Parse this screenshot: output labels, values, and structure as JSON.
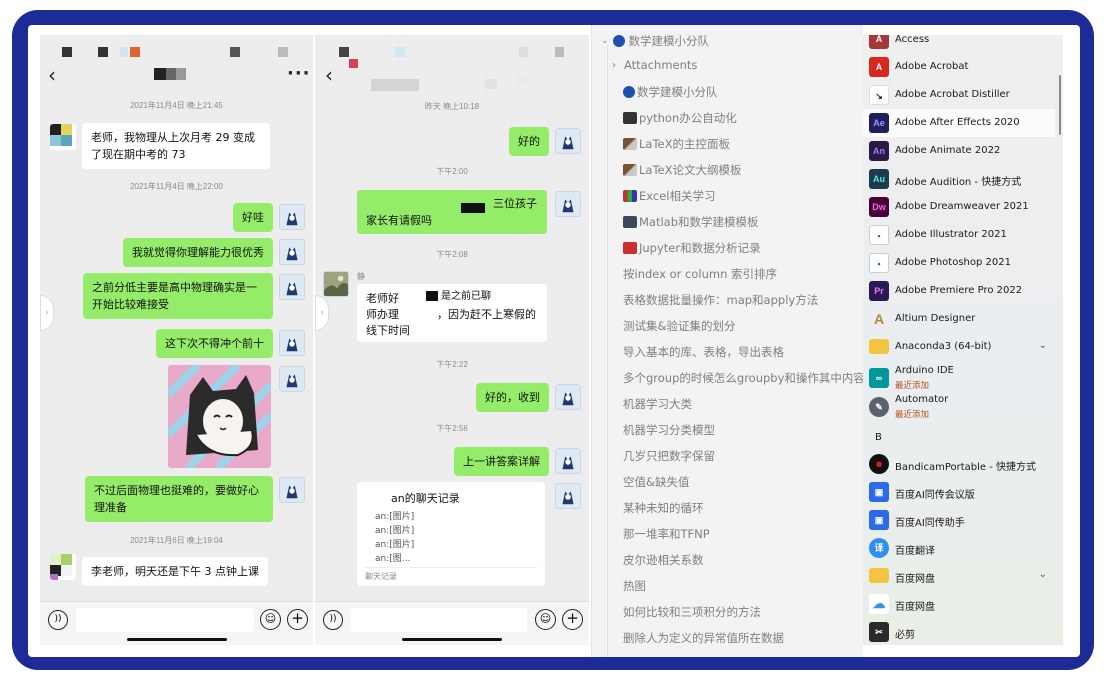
{
  "chat_left": {
    "timestamps": [
      "2021年11月4日 晚上21:45",
      "2021年11月4日 晚上22:00",
      "2021年11月6日 晚上19:04"
    ],
    "messages": [
      {
        "from": "student",
        "text": "老师，我物理从上次月考 29 变成了现在期中考的 73"
      },
      {
        "from": "teacher",
        "text": "好哇"
      },
      {
        "from": "teacher",
        "text": "我就觉得你理解能力很优秀"
      },
      {
        "from": "teacher",
        "text": "之前分低主要是高中物理确实是一开始比较难接受"
      },
      {
        "from": "teacher",
        "text": "这下次不得冲个前十"
      },
      {
        "from": "teacher",
        "text": "不过后面物理也挺难的，要做好心理准备"
      },
      {
        "from": "student",
        "text": "李老师，明天还是下午 3 点钟上课"
      }
    ]
  },
  "chat_right": {
    "timestamps": [
      "昨天 晚上10:18",
      "下午2:00",
      "下午2:08",
      "下午2:22",
      "下午2:56"
    ],
    "messages": [
      {
        "from": "teacher",
        "text": "好的"
      },
      {
        "from": "teacher",
        "text": "三位孩子",
        "text2": "家长有请假吗"
      },
      {
        "from": "parent",
        "name": "静",
        "text": "老师好",
        "text_frag1": "是之前已聊",
        "text2": "师办理",
        "text_frag2": "，因为赶不上寒假的",
        "text3": "线下时间"
      },
      {
        "from": "teacher",
        "text": "好的，收到"
      },
      {
        "from": "teacher",
        "text": "上一讲答案详解"
      }
    ],
    "record_card": {
      "title": "an的聊天记录",
      "lines": [
        "an:[图片]",
        "an:[图片]",
        "an:[图片]",
        "an:[图..."
      ],
      "footer": "聊天记录"
    }
  },
  "tree": {
    "root": "数学建模小分队",
    "items": [
      "Attachments",
      "数学建模小分队",
      "python办公自动化",
      "LaTeX的主控面板",
      "LaTeX论文大纲模板",
      "Excel相关学习",
      "Matlab和数学建模模板",
      "Jupyter和数据分析记录",
      "按index or column 索引排序",
      "表格数据批量操作：map和apply方法",
      "测试集&验证集的划分",
      "导入基本的库、表格，导出表格",
      "多个group的时候怎么groupby和操作其中内容",
      "机器学习大类",
      "机器学习分类模型",
      "几岁只把数字保留",
      "空值&缺失值",
      "某种未知的循环",
      "那一堆率和TFNP",
      "皮尔逊相关系数",
      "热图",
      "如何比较和三项积分的方法",
      "删除人为定义的异常值所在数据"
    ]
  },
  "start_menu": {
    "apps": [
      {
        "name": "Access",
        "icon": "access-icon",
        "color": "#a4373a",
        "glyph": "A"
      },
      {
        "name": "Adobe Acrobat",
        "icon": "acrobat-icon",
        "color": "#d9271e",
        "glyph": "A"
      },
      {
        "name": "Adobe Acrobat Distiller",
        "icon": "distiller-icon",
        "color": "#ffffff",
        "glyph": "↘"
      },
      {
        "name": "Adobe After Effects 2020",
        "icon": "after-effects-icon",
        "color": "#1f1f5c",
        "glyph": "Ae"
      },
      {
        "name": "Adobe Animate 2022",
        "icon": "animate-icon",
        "color": "#2a1a45",
        "glyph": "An"
      },
      {
        "name": "Adobe Audition - 快捷方式",
        "icon": "audition-icon",
        "color": "#1c3b50",
        "glyph": "Au"
      },
      {
        "name": "Adobe Dreamweaver 2021",
        "icon": "dreamweaver-icon",
        "color": "#470137",
        "glyph": "Dw"
      },
      {
        "name": "Adobe Illustrator 2021",
        "icon": "illustrator-icon",
        "color": "#1f6fd1",
        "glyph": "▪"
      },
      {
        "name": "Adobe Photoshop 2021",
        "icon": "photoshop-icon",
        "color": "#1f6fd1",
        "glyph": "▪"
      },
      {
        "name": "Adobe Premiere Pro 2022",
        "icon": "premiere-icon",
        "color": "#2a1a54",
        "glyph": "Pr"
      },
      {
        "name": "Altium Designer",
        "icon": "altium-icon",
        "color": "#e9e2d0",
        "glyph": "A"
      },
      {
        "name": "Anaconda3 (64-bit)",
        "icon": "folder-icon",
        "color": "#f2c440",
        "glyph": ""
      },
      {
        "name": "Arduino IDE",
        "icon": "arduino-icon",
        "color": "#00979c",
        "glyph": "∞",
        "sub": "最近添加"
      },
      {
        "name": "Automator",
        "icon": "automator-icon",
        "color": "#5a6270",
        "glyph": "✎",
        "sub": "最近添加"
      },
      {
        "name": "BandicamPortable - 快捷方式",
        "icon": "bandicam-icon",
        "color": "#111111",
        "glyph": "●"
      },
      {
        "name": "百度AI同传会议版",
        "icon": "baidu-ai-meeting-icon",
        "color": "#2b6be8",
        "glyph": "▣"
      },
      {
        "name": "百度AI同传助手",
        "icon": "baidu-ai-assistant-icon",
        "color": "#2b6be8",
        "glyph": "▣"
      },
      {
        "name": "百度翻译",
        "icon": "baidu-translate-icon",
        "color": "#2f8ff0",
        "glyph": "译"
      },
      {
        "name": "百度网盘",
        "icon": "folder-icon",
        "color": "#f2c440",
        "glyph": ""
      },
      {
        "name": "百度网盘",
        "icon": "baidu-netdisk-icon",
        "color": "#3a8ff7",
        "glyph": "☁"
      },
      {
        "name": "必剪",
        "icon": "bijian-icon",
        "color": "#2a2a2a",
        "glyph": "✂"
      }
    ],
    "section_letter": "B",
    "highlighted": "Adobe After Effects 2020"
  }
}
